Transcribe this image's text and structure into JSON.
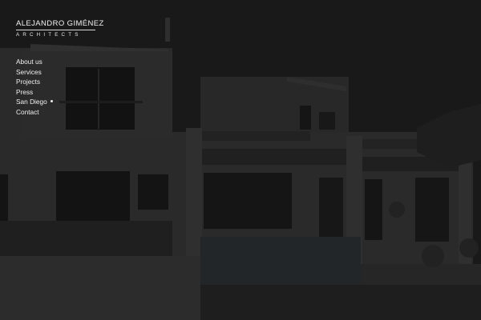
{
  "brand": {
    "name": "ALEJANDRO GIMÉNEZ",
    "subtitle": "ARCHITECTS"
  },
  "nav": {
    "items": [
      {
        "label": "About us"
      },
      {
        "label": "Services"
      },
      {
        "label": "Projects"
      },
      {
        "label": "Press"
      },
      {
        "label": "San Diego"
      },
      {
        "label": "Contact"
      }
    ]
  },
  "colors": {
    "background": "#1a1a1a",
    "text": "#f0f0f0"
  },
  "icons": {
    "active_indicator": "dot-icon"
  }
}
